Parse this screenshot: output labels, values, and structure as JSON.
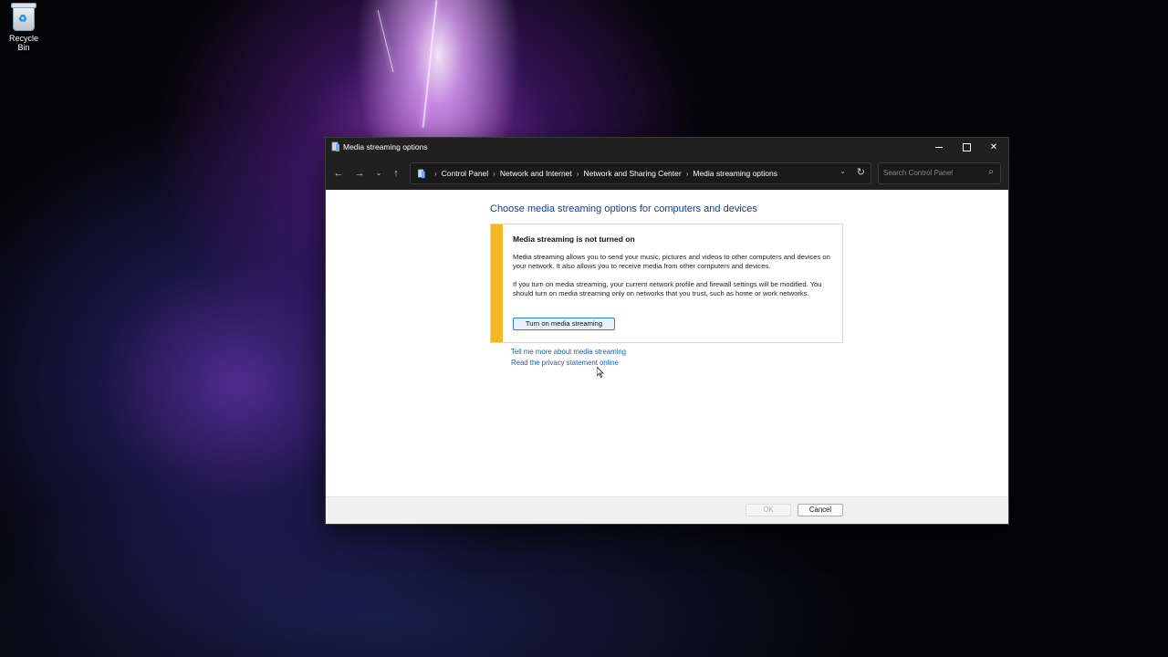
{
  "desktop": {
    "icons": [
      {
        "label": "Recycle Bin",
        "icon": "recycle-bin-icon"
      }
    ]
  },
  "window": {
    "title": "Media streaming options",
    "controls": {
      "minimize": "minimize-icon",
      "maximize": "maximize-icon",
      "close": "close-icon"
    }
  },
  "navigation": {
    "back": "←",
    "forward": "→",
    "recent": "⌄",
    "up": "↑"
  },
  "address_bar": {
    "breadcrumbs": [
      "Control Panel",
      "Network and Internet",
      "Network and Sharing Center",
      "Media streaming options"
    ],
    "separator": "›"
  },
  "search": {
    "placeholder": "Search Control Panel",
    "value": ""
  },
  "main": {
    "heading": "Choose media streaming options for computers and devices",
    "panel": {
      "title": "Media streaming is not turned on",
      "paragraph1": "Media streaming allows you to send your music, pictures and videos to other computers and devices on your network.  It also allows you to receive media from other computers and devices.",
      "paragraph2": "If you turn on media streaming, your current network profile and firewall settings will be modified. You should turn on media streaming only on networks that you trust, such as home or work networks.",
      "button_label": "Turn on media streaming",
      "accent_color": "#F2B824"
    },
    "links": [
      "Tell me more about media streaming",
      "Read the privacy statement online"
    ]
  },
  "footer": {
    "ok_label": "OK",
    "cancel_label": "Cancel"
  }
}
